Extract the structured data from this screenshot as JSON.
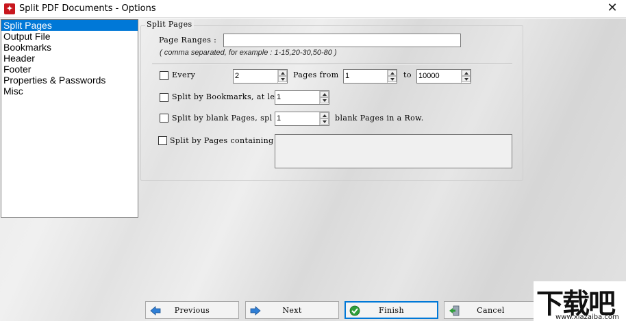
{
  "window": {
    "title": "Split PDF Documents - Options",
    "close_glyph": "✕"
  },
  "sidebar": {
    "items": [
      {
        "label": "Split Pages",
        "selected": true
      },
      {
        "label": "Output File"
      },
      {
        "label": "Bookmarks"
      },
      {
        "label": "Header"
      },
      {
        "label": "Footer"
      },
      {
        "label": "Properties & Passwords"
      },
      {
        "label": "Misc"
      }
    ]
  },
  "panel": {
    "title": "Split Pages",
    "page_ranges_label": "Page Ranges :",
    "page_ranges_value": "",
    "page_ranges_hint": "( comma separated, for example : 1-15,20-30,50-80 )",
    "every": {
      "label": "Every",
      "value": "2",
      "pages_from_label": "Pages from",
      "from_value": "1",
      "to_label": "to",
      "to_value": "10000"
    },
    "bookmarks": {
      "label": "Split by Bookmarks, at le",
      "value": "1"
    },
    "blank": {
      "label": "Split by blank Pages, spl",
      "value": "1",
      "suffix": "blank Pages in a Row."
    },
    "containing": {
      "label": "Split by Pages containing",
      "value": ""
    }
  },
  "buttons": {
    "previous": "Previous",
    "next": "Next",
    "finish": "Finish",
    "cancel": "Cancel"
  },
  "watermark": {
    "brand": "下载吧",
    "url": "www.xiazaiba.com"
  },
  "colors": {
    "selection": "#0078d7",
    "app_icon": "#c8161d"
  }
}
